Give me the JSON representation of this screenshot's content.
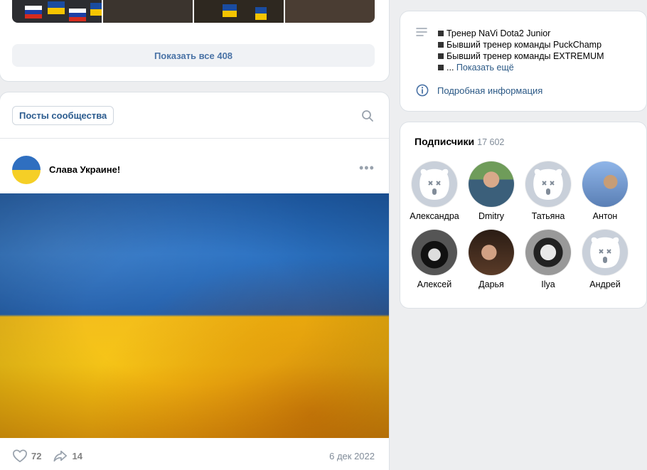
{
  "photos": {
    "show_all_label": "Показать все 408"
  },
  "posts": {
    "tab_label": "Посты сообщества",
    "post": {
      "author": "Слава Украине!",
      "likes": "72",
      "shares": "14",
      "date": "6 дек 2022"
    }
  },
  "info": {
    "items": [
      "Тренер NaVi Dota2 Junior",
      "Бывший тренер команды PuckChamp",
      "Бывший тренер команды EXTREMUM"
    ],
    "ellipsis": "...",
    "show_more": "Показать ещё",
    "details_label": "Подробная информация"
  },
  "followers": {
    "title": "Подписчики",
    "count": "17 602",
    "people": [
      {
        "name": "Александра",
        "avatar": "dog-placeholder-icon"
      },
      {
        "name": "Dmitry",
        "avatar": "photo"
      },
      {
        "name": "Татьяна",
        "avatar": "dog-placeholder-icon"
      },
      {
        "name": "Антон",
        "avatar": "photo"
      },
      {
        "name": "Алексей",
        "avatar": "photo"
      },
      {
        "name": "Дарья",
        "avatar": "photo"
      },
      {
        "name": "Ilya",
        "avatar": "photo"
      },
      {
        "name": "Андрей",
        "avatar": "dog-placeholder-icon"
      }
    ]
  },
  "colors": {
    "link": "#2a5885",
    "accent": "#4a73a6",
    "background": "#edeef0",
    "flag_blue": "#1f5fae",
    "flag_yellow": "#f3bb10"
  }
}
